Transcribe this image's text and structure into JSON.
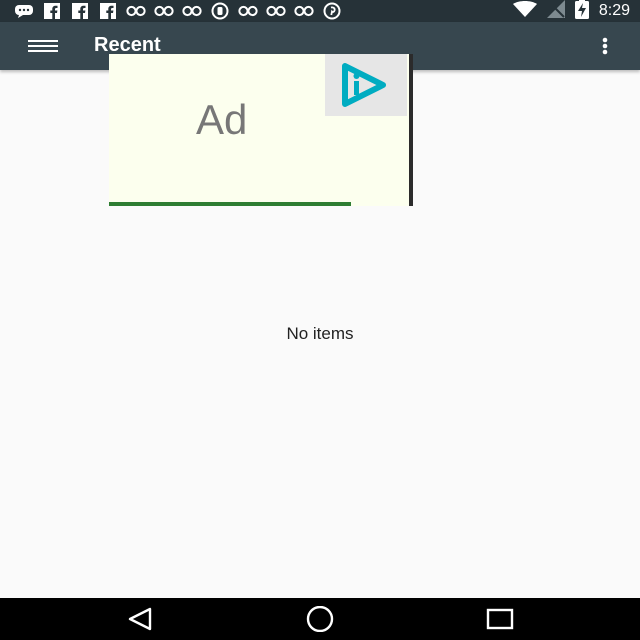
{
  "status_bar": {
    "time": "8:29",
    "notification_icons": [
      "message-icon",
      "facebook-icon",
      "facebook-icon",
      "facebook-icon",
      "link-icon",
      "link-icon",
      "link-icon",
      "b-icon",
      "link-icon",
      "link-icon",
      "link-icon",
      "pinterest-icon"
    ],
    "system_icons": [
      "wifi-icon",
      "no-signal-icon",
      "battery-charging-icon"
    ]
  },
  "toolbar": {
    "title": "Recent",
    "menu_icon": "hamburger-menu-icon",
    "overflow_icon": "more-vert-icon"
  },
  "ad": {
    "label": "Ad",
    "badge_icon": "ad-choices-icon"
  },
  "content": {
    "empty_text": "No items"
  },
  "nav_bar": {
    "icons": [
      "back-icon",
      "home-icon",
      "recents-icon"
    ]
  },
  "colors": {
    "status_bar": "#263238",
    "toolbar": "#37474f",
    "background": "#fafafa",
    "ad_background": "#fcffee",
    "ad_badge_accent": "#00acc1"
  }
}
